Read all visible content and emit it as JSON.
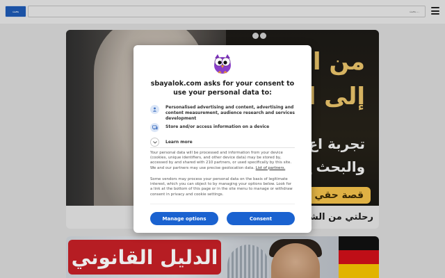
{
  "header": {
    "search_button_label": "بحث",
    "search_placeholder": "بحث..."
  },
  "articles": [
    {
      "image_text": {
        "line1": "من ال",
        "line2": "إلى ال",
        "line3": "تجربة اع",
        "line4": "والبحث ع",
        "pill": "قصة حقي"
      },
      "title": "رحلتي من الشك ... وج مسلم"
    },
    {
      "image_text": {
        "banner": "الدليل القانوني"
      }
    }
  ],
  "consent": {
    "title": "sbayalok.com asks for your consent to use your personal data to:",
    "purposes": [
      {
        "icon": "person-icon",
        "text": "Personalised advertising and content, advertising and content measurement, audience research and services development"
      },
      {
        "icon": "device-icon",
        "text": "Store and/or access information on a device"
      }
    ],
    "learn_more": "Learn more",
    "paragraph1_pre": "Your personal data will be processed and information from your device (cookies, unique identifiers, and other device data) may be stored by, accessed by and shared with 210 partners, or used specifically by this site. We and our partners may use precise geolocation data.",
    "paragraph1_link": "List of partners.",
    "paragraph2": "Some vendors may process your personal data on the basis of legitimate interest, which you can object to by managing your options below. Look for a link at the bottom of this page or in the site menu to manage or withdraw consent in privacy and cookie settings.",
    "manage_label": "Manage options",
    "consent_label": "Consent"
  },
  "colors": {
    "accent": "#1a62d0",
    "header_button": "#1e5ab3",
    "gold_text": "#e9c36a",
    "banner_red": "#c62026"
  }
}
